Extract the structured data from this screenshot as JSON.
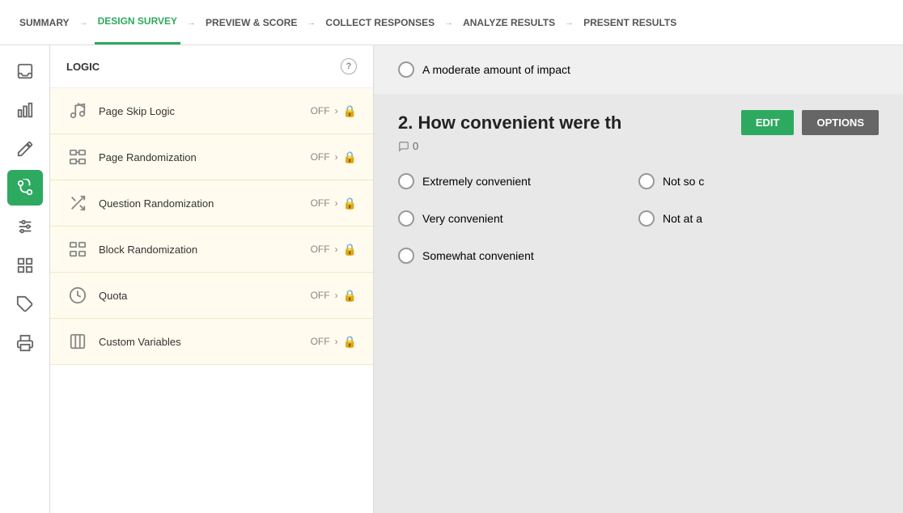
{
  "nav": {
    "items": [
      {
        "label": "SUMMARY",
        "active": false
      },
      {
        "label": "DESIGN SURVEY",
        "active": true
      },
      {
        "label": "PREVIEW & SCORE",
        "active": false
      },
      {
        "label": "COLLECT RESPONSES",
        "active": false
      },
      {
        "label": "ANALYZE RESULTS",
        "active": false
      },
      {
        "label": "PRESENT RESULTS",
        "active": false
      }
    ]
  },
  "logic_panel": {
    "header": "LOGIC",
    "help_tooltip": "?",
    "items": [
      {
        "label": "Page Skip Logic",
        "status": "OFF",
        "locked": true
      },
      {
        "label": "Page Randomization",
        "status": "OFF",
        "locked": true
      },
      {
        "label": "Question Randomization",
        "status": "OFF",
        "locked": true
      },
      {
        "label": "Block Randomization",
        "status": "OFF",
        "locked": true
      },
      {
        "label": "Quota",
        "status": "OFF",
        "locked": true
      },
      {
        "label": "Custom Variables",
        "status": "OFF",
        "locked": true
      }
    ]
  },
  "content": {
    "top_option": "A moderate amount of impact",
    "question_number": "2.",
    "question_text": "How convenient were th",
    "comment_count": "0",
    "edit_label": "EDIT",
    "options_label": "OPTIONS",
    "comment_icon_count": "0",
    "answers_left": [
      "Extremely convenient",
      "Very convenient",
      "Somewhat convenient"
    ],
    "answers_right": [
      "Not so c",
      "Not at a"
    ]
  },
  "icons": {
    "inbox": "⊟",
    "chart": "▦",
    "pencil": "✏",
    "logic": "✂",
    "sliders": "⊞",
    "grid": "⊞",
    "tag": "⬡",
    "print": "⎙"
  }
}
